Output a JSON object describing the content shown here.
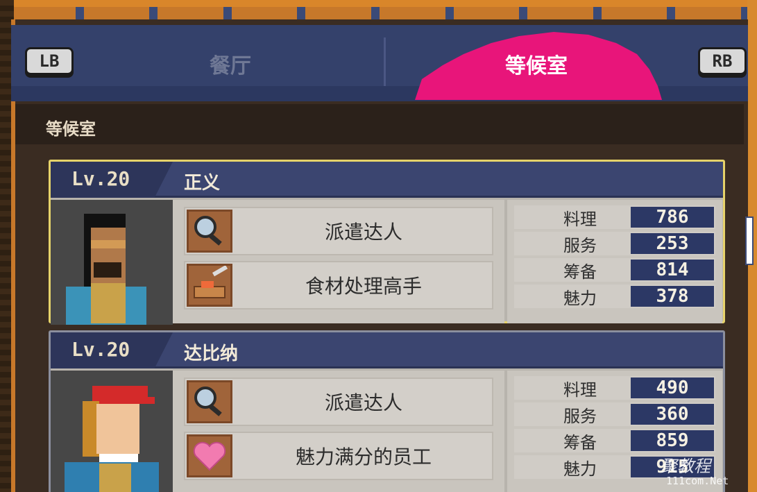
{
  "header": {
    "left_button": "LB",
    "right_button": "RB",
    "tabs": [
      {
        "label": "餐厅",
        "active": false
      },
      {
        "label": "等候室",
        "active": true
      }
    ],
    "accent_color": "#e8157a"
  },
  "section": {
    "title": "等候室"
  },
  "staff": [
    {
      "level": "Lv.20",
      "name": "正义",
      "selected": true,
      "skills": [
        {
          "icon": "magnifier-icon",
          "label": "派遣达人"
        },
        {
          "icon": "knife-cutting-board-icon",
          "label": "食材处理高手"
        }
      ],
      "stats": [
        {
          "label": "料理",
          "value": "786"
        },
        {
          "label": "服务",
          "value": "253"
        },
        {
          "label": "筹备",
          "value": "814"
        },
        {
          "label": "魅力",
          "value": "378"
        }
      ]
    },
    {
      "level": "Lv.20",
      "name": "达比纳",
      "selected": false,
      "skills": [
        {
          "icon": "magnifier-icon",
          "label": "派遣达人"
        },
        {
          "icon": "heart-icon",
          "label": "魅力满分的员工"
        }
      ],
      "stats": [
        {
          "label": "料理",
          "value": "490"
        },
        {
          "label": "服务",
          "value": "360"
        },
        {
          "label": "筹备",
          "value": "859"
        },
        {
          "label": "魅力",
          "value": "915"
        }
      ]
    }
  ],
  "watermark": {
    "main": "聚教程",
    "sub": "111com.Net"
  }
}
